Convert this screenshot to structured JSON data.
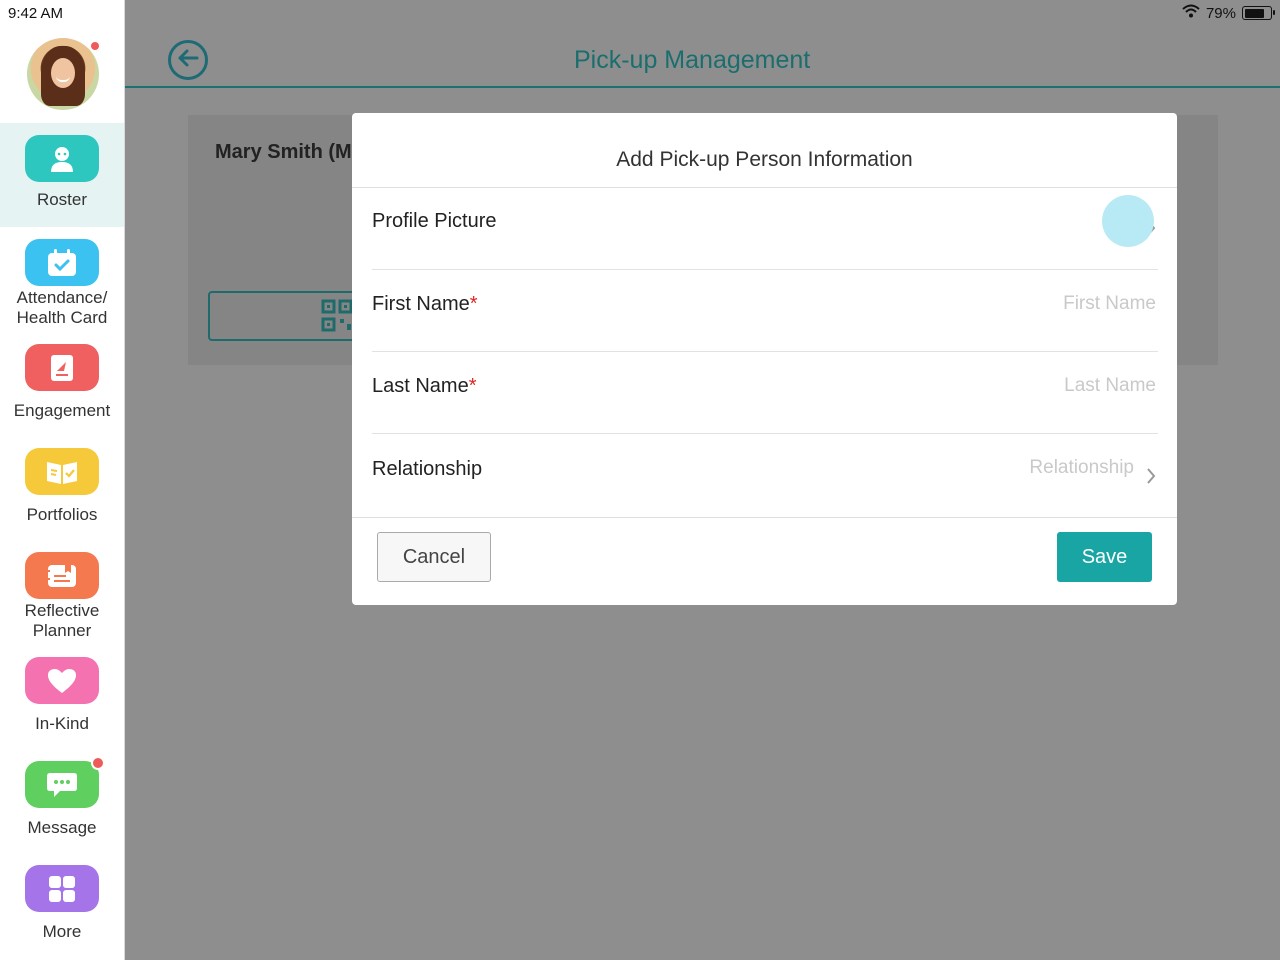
{
  "status_bar": {
    "time": "9:42 AM",
    "battery": "79%",
    "battery_level": 0.79
  },
  "sidebar": {
    "items": [
      {
        "label": "Roster",
        "icon": "person-icon",
        "color": "#2ec7c0",
        "active": true
      },
      {
        "label": "Attendance/\nHealth Card",
        "icon": "calendar-check-icon",
        "color": "#3cc2f0"
      },
      {
        "label": "Engagement",
        "icon": "book-icon",
        "color": "#f06060"
      },
      {
        "label": "Portfolios",
        "icon": "open-book-icon",
        "color": "#f5c93a"
      },
      {
        "label": "Reflective\nPlanner",
        "icon": "planner-icon",
        "color": "#f5794f"
      },
      {
        "label": "In-Kind",
        "icon": "heart-icon",
        "color": "#f472b0"
      },
      {
        "label": "Message",
        "icon": "chat-icon",
        "color": "#5fcf5f"
      },
      {
        "label": "More",
        "icon": "grid-icon",
        "color": "#a474e8"
      }
    ]
  },
  "header": {
    "title": "Pick-up Management"
  },
  "background": {
    "student_name": "Mary Smith (M"
  },
  "modal": {
    "title": "Add Pick-up Person Information",
    "profile_picture_label": "Profile Picture",
    "first_name_label": "First Name",
    "first_name_placeholder": "First Name",
    "last_name_label": "Last Name",
    "last_name_placeholder": "Last Name",
    "relationship_label": "Relationship",
    "relationship_placeholder": "Relationship",
    "required_marker": "*",
    "cancel_label": "Cancel",
    "save_label": "Save"
  },
  "colors": {
    "accent": "#1aa5a5",
    "header_text": "#1b6e6e"
  }
}
